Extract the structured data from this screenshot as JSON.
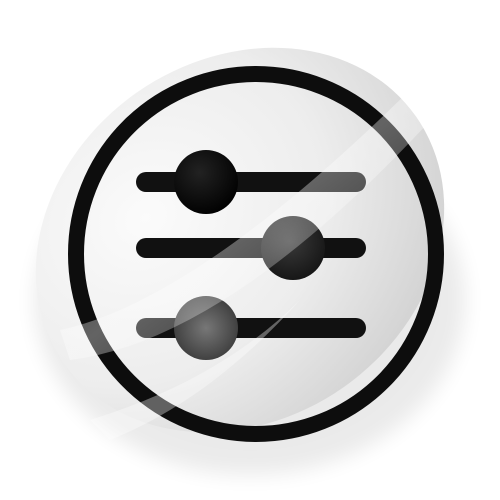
{
  "icon": {
    "name": "sliders-settings-icon",
    "style": "glossy-glass-circle",
    "colors": {
      "background": "#ffffff",
      "ring": "#0d0d0d",
      "track": "#111111",
      "knob_top": "#000000",
      "knob_middle": "#1a1a1a",
      "knob_bottom": "#2a2a2a",
      "glass_light": "#f4f4f4",
      "glass_dark": "#cfcfcf"
    },
    "sliders": [
      {
        "name": "slider-top",
        "knob_position": 0.28
      },
      {
        "name": "slider-middle",
        "knob_position": 0.67
      },
      {
        "name": "slider-bottom",
        "knob_position": 0.28
      }
    ]
  }
}
